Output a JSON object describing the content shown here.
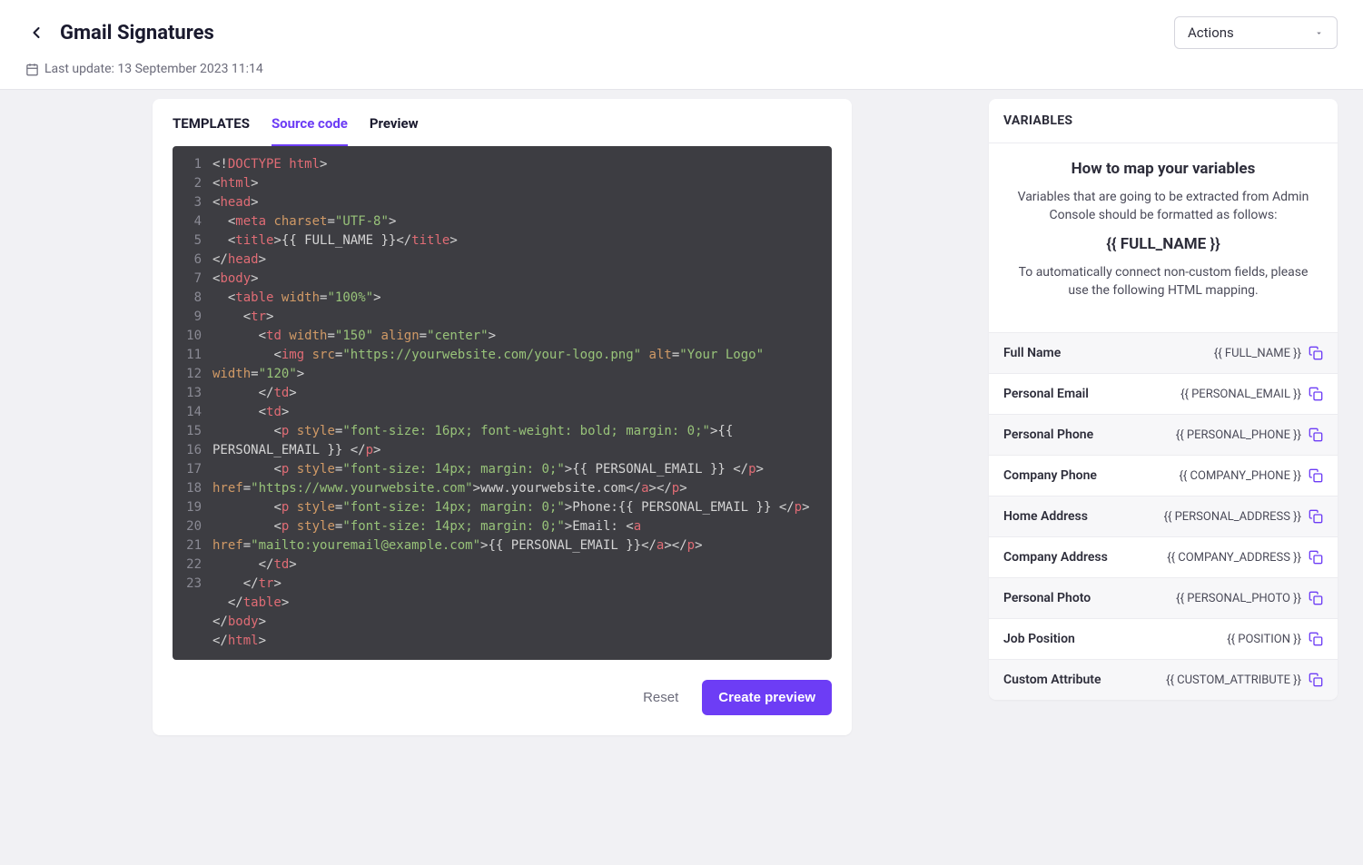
{
  "header": {
    "title": "Gmail Signatures",
    "actions_label": "Actions",
    "last_update_label": "Last update: 13 September 2023 11:14"
  },
  "tabs": {
    "templates": "TEMPLATES",
    "source": "Source code",
    "preview": "Preview",
    "active": "source"
  },
  "buttons": {
    "reset": "Reset",
    "create_preview": "Create preview"
  },
  "code": {
    "lines": [
      "1",
      "2",
      "3",
      "4",
      "5",
      "6",
      "7",
      "8",
      "9",
      "10",
      "11",
      "12",
      "13",
      "14",
      "15",
      "16",
      "17",
      "18",
      "19",
      "20",
      "21",
      "22",
      "23"
    ],
    "l1": "<!DOCTYPE html>",
    "src_url": "https://yourwebsite.com/your-logo.png",
    "alt_text": "Your Logo",
    "width_100": "100%",
    "width_150": "150",
    "width_120": "120",
    "align_center": "center",
    "utf8": "UTF-8",
    "title_text": "{{ FULL_NAME }}",
    "style15": "font-size: 16px; font-weight: bold; margin: 0;",
    "text15": "{{ ",
    "text16pre": "PERSONAL_EMAIL }} ",
    "style17": "font-size: 14px; margin: 0;",
    "text17": "{{ PERSONAL_EMAIL }} ",
    "href18": "https://www.yourwebsite.com",
    "text18": "www.yourwebsite.com",
    "style19": "font-size: 14px; margin: 0;",
    "text19": "Phone:{{ PERSONAL_EMAIL }} ",
    "style20": "font-size: 14px; margin: 0;",
    "text20": "Email: ",
    "href21": "mailto:youremail@example.com",
    "text21": "{{ PERSONAL_EMAIL }}"
  },
  "sidebar": {
    "title": "VARIABLES",
    "heading": "How to map your variables",
    "desc1": "Variables that are going to be extracted from Admin Console should be formatted as follows:",
    "example": "{{ FULL_NAME }}",
    "desc2": "To automatically connect non-custom fields, please use the following HTML mapping.",
    "rows": [
      {
        "label": "Full Name",
        "token": "{{ FULL_NAME }}"
      },
      {
        "label": "Personal Email",
        "token": "{{ PERSONAL_EMAIL }}"
      },
      {
        "label": "Personal Phone",
        "token": "{{ PERSONAL_PHONE }}"
      },
      {
        "label": "Company Phone",
        "token": "{{ COMPANY_PHONE }}"
      },
      {
        "label": "Home Address",
        "token": "{{ PERSONAL_ADDRESS }}"
      },
      {
        "label": "Company Address",
        "token": "{{ COMPANY_ADDRESS }}"
      },
      {
        "label": "Personal Photo",
        "token": "{{ PERSONAL_PHOTO }}"
      },
      {
        "label": "Job Position",
        "token": "{{ POSITION }}"
      },
      {
        "label": "Custom Attribute",
        "token": "{{ CUSTOM_ATTRIBUTE }}"
      }
    ]
  }
}
